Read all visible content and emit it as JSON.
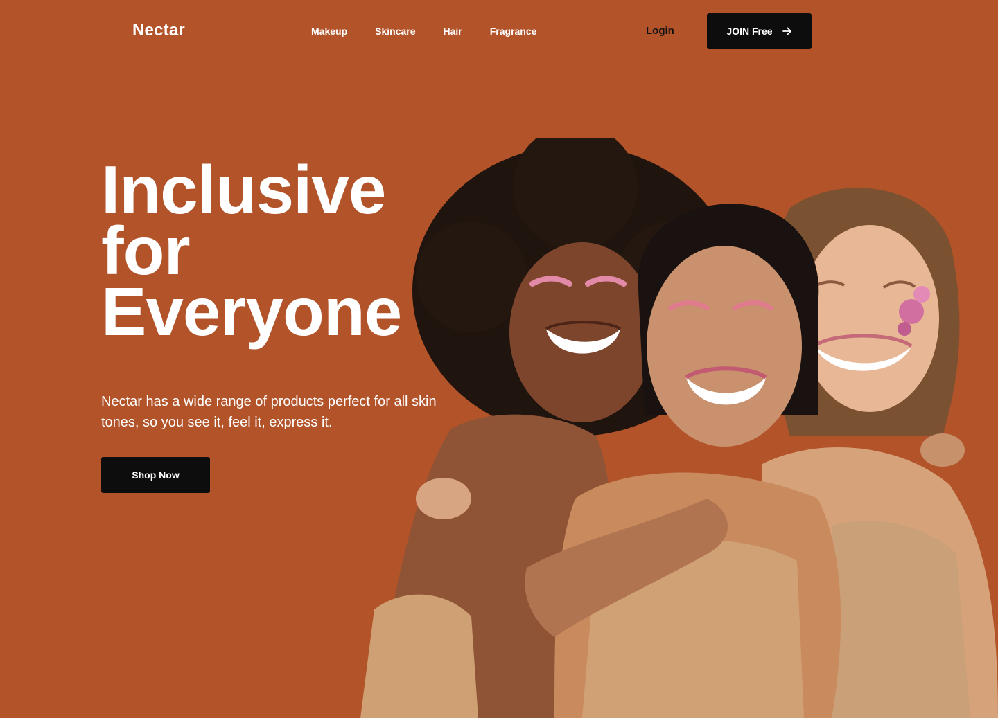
{
  "brand": {
    "logo_text": "Nectar"
  },
  "nav": {
    "links": [
      {
        "label": "Makeup"
      },
      {
        "label": "Skincare"
      },
      {
        "label": "Hair"
      },
      {
        "label": "Fragrance"
      }
    ],
    "login_label": "Login",
    "join_label": "JOIN Free",
    "join_icon": "arrow-right-icon"
  },
  "hero": {
    "title_lines": [
      "Inclusive",
      "for",
      "Everyone"
    ],
    "subtitle": "Nectar has a wide range of products perfect for all skin tones, so you see it, feel it, express it.",
    "cta_label": "Shop Now",
    "image": "three-smiling-women-photo"
  },
  "colors": {
    "background": "#B35329",
    "button": "#0D0D0D",
    "text_light": "#FFFFFF",
    "text_dark": "#111111"
  }
}
